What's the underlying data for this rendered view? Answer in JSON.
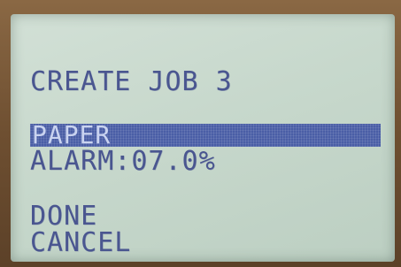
{
  "screen": {
    "title": "CREATE JOB 3",
    "menu": [
      {
        "label": "PAPER"
      },
      {
        "label": "ALARM:",
        "value": "07.0%"
      }
    ],
    "actions": {
      "done": "DONE",
      "cancel": "CANCEL"
    }
  },
  "colors": {
    "lcd_background": "#c7d8cc",
    "lcd_text": "#4a5690",
    "selection_bar": "#4a5ea6"
  }
}
